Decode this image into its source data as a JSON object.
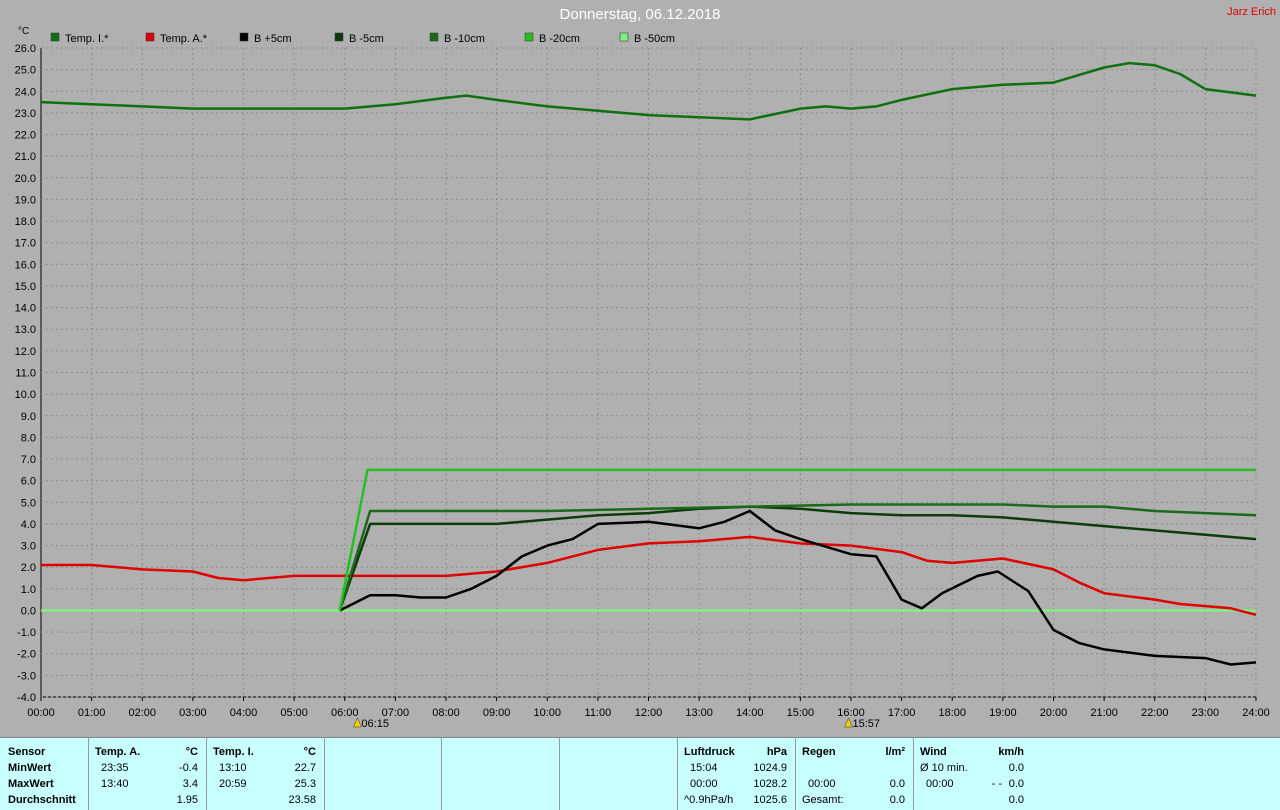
{
  "title": "Donnerstag, 06.12.2018",
  "user": "Jarz Erich",
  "unit": "°C",
  "legend": [
    {
      "label": "Temp. I.*",
      "color": "#107010"
    },
    {
      "label": "Temp. A.*",
      "color": "#e00000"
    },
    {
      "label": "B +5cm",
      "color": "#000000"
    },
    {
      "label": "B -5cm",
      "color": "#0c3c0c"
    },
    {
      "label": "B -10cm",
      "color": "#1a6a1a"
    },
    {
      "label": "B -20cm",
      "color": "#22c022"
    },
    {
      "label": "B -50cm",
      "color": "#80f080"
    }
  ],
  "sunrise": "06:15",
  "sunset": "15:57",
  "colors": {
    "background": "#b0b0b0",
    "panel": "#c8ffff",
    "title": "#ffffff",
    "user": "#e00000"
  },
  "chart_data": {
    "type": "line",
    "title": "Donnerstag, 06.12.2018",
    "ylabel": "°C",
    "ylim": [
      -4,
      26
    ],
    "xlim": [
      0,
      24
    ],
    "x_ticks": [
      "00:00",
      "01:00",
      "02:00",
      "03:00",
      "04:00",
      "05:00",
      "06:00",
      "07:00",
      "08:00",
      "09:00",
      "10:00",
      "11:00",
      "12:00",
      "13:00",
      "14:00",
      "15:00",
      "16:00",
      "17:00",
      "18:00",
      "19:00",
      "20:00",
      "21:00",
      "22:00",
      "23:00",
      "24:00"
    ],
    "y_ticks": [
      "-4.0",
      "-3.0",
      "-2.0",
      "-1.0",
      "0.0",
      "1.0",
      "2.0",
      "3.0",
      "4.0",
      "5.0",
      "6.0",
      "7.0",
      "8.0",
      "9.0",
      "10.0",
      "11.0",
      "12.0",
      "13.0",
      "14.0",
      "15.0",
      "16.0",
      "17.0",
      "18.0",
      "19.0",
      "20.0",
      "21.0",
      "22.0",
      "23.0",
      "24.0",
      "25.0",
      "26.0"
    ],
    "grid": true,
    "series": [
      {
        "name": "Temp. I.*",
        "color": "#107010",
        "points": [
          [
            0,
            23.5
          ],
          [
            1,
            23.4
          ],
          [
            2,
            23.3
          ],
          [
            3,
            23.2
          ],
          [
            4,
            23.2
          ],
          [
            5,
            23.2
          ],
          [
            6,
            23.2
          ],
          [
            7,
            23.4
          ],
          [
            8,
            23.7
          ],
          [
            8.4,
            23.8
          ],
          [
            9,
            23.6
          ],
          [
            10,
            23.3
          ],
          [
            11,
            23.1
          ],
          [
            12,
            22.9
          ],
          [
            13,
            22.8
          ],
          [
            14,
            22.7
          ],
          [
            15,
            23.2
          ],
          [
            15.5,
            23.3
          ],
          [
            16,
            23.2
          ],
          [
            16.5,
            23.3
          ],
          [
            17,
            23.6
          ],
          [
            18,
            24.1
          ],
          [
            19,
            24.3
          ],
          [
            20,
            24.4
          ],
          [
            21,
            25.1
          ],
          [
            21.5,
            25.3
          ],
          [
            22,
            25.2
          ],
          [
            22.5,
            24.8
          ],
          [
            23,
            24.1
          ],
          [
            24,
            23.8
          ]
        ]
      },
      {
        "name": "Temp. A.*",
        "color": "#e00000",
        "points": [
          [
            0,
            2.1
          ],
          [
            1,
            2.1
          ],
          [
            2,
            1.9
          ],
          [
            3,
            1.8
          ],
          [
            3.5,
            1.5
          ],
          [
            4,
            1.4
          ],
          [
            5,
            1.6
          ],
          [
            6,
            1.6
          ],
          [
            7,
            1.6
          ],
          [
            8,
            1.6
          ],
          [
            9,
            1.8
          ],
          [
            10,
            2.2
          ],
          [
            11,
            2.8
          ],
          [
            12,
            3.1
          ],
          [
            13,
            3.2
          ],
          [
            14,
            3.4
          ],
          [
            15,
            3.1
          ],
          [
            16,
            3.0
          ],
          [
            17,
            2.7
          ],
          [
            17.5,
            2.3
          ],
          [
            18,
            2.2
          ],
          [
            19,
            2.4
          ],
          [
            20,
            1.9
          ],
          [
            20.5,
            1.3
          ],
          [
            21,
            0.8
          ],
          [
            22,
            0.5
          ],
          [
            22.5,
            0.3
          ],
          [
            23,
            0.2
          ],
          [
            23.5,
            0.1
          ],
          [
            24,
            -0.2
          ]
        ]
      },
      {
        "name": "B +5cm",
        "color": "#000000",
        "points": [
          [
            5.9,
            0
          ],
          [
            6.5,
            0.7
          ],
          [
            7,
            0.7
          ],
          [
            7.5,
            0.6
          ],
          [
            8,
            0.6
          ],
          [
            8.5,
            1.0
          ],
          [
            9,
            1.6
          ],
          [
            9.5,
            2.5
          ],
          [
            10,
            3.0
          ],
          [
            10.5,
            3.3
          ],
          [
            11,
            4.0
          ],
          [
            12,
            4.1
          ],
          [
            13,
            3.8
          ],
          [
            13.5,
            4.1
          ],
          [
            14,
            4.6
          ],
          [
            14.5,
            3.7
          ],
          [
            15,
            3.3
          ],
          [
            16,
            2.6
          ],
          [
            16.5,
            2.5
          ],
          [
            17,
            0.5
          ],
          [
            17.4,
            0.1
          ],
          [
            17.8,
            0.8
          ],
          [
            18.5,
            1.6
          ],
          [
            18.9,
            1.8
          ],
          [
            19.5,
            0.9
          ],
          [
            20,
            -0.9
          ],
          [
            20.5,
            -1.5
          ],
          [
            21,
            -1.8
          ],
          [
            22,
            -2.1
          ],
          [
            23,
            -2.2
          ],
          [
            23.5,
            -2.5
          ],
          [
            24,
            -2.4
          ]
        ]
      },
      {
        "name": "B -5cm",
        "color": "#0c3c0c",
        "points": [
          [
            5.9,
            0
          ],
          [
            6.5,
            4.0
          ],
          [
            8,
            4.0
          ],
          [
            9,
            4.0
          ],
          [
            10,
            4.2
          ],
          [
            11,
            4.4
          ],
          [
            12,
            4.5
          ],
          [
            13,
            4.7
          ],
          [
            14,
            4.8
          ],
          [
            15,
            4.7
          ],
          [
            16,
            4.5
          ],
          [
            17,
            4.4
          ],
          [
            18,
            4.4
          ],
          [
            19,
            4.3
          ],
          [
            20,
            4.1
          ],
          [
            21,
            3.9
          ],
          [
            22,
            3.7
          ],
          [
            23,
            3.5
          ],
          [
            24,
            3.3
          ]
        ]
      },
      {
        "name": "B -10cm",
        "color": "#1a6a1a",
        "points": [
          [
            5.9,
            0
          ],
          [
            6.5,
            4.6
          ],
          [
            8,
            4.6
          ],
          [
            10,
            4.6
          ],
          [
            12,
            4.7
          ],
          [
            14,
            4.8
          ],
          [
            16,
            4.9
          ],
          [
            18,
            4.9
          ],
          [
            19,
            4.9
          ],
          [
            20,
            4.8
          ],
          [
            21,
            4.8
          ],
          [
            22,
            4.6
          ],
          [
            23,
            4.5
          ],
          [
            24,
            4.4
          ]
        ]
      },
      {
        "name": "B -20cm",
        "color": "#22c022",
        "points": [
          [
            5.9,
            0
          ],
          [
            6.45,
            6.5
          ],
          [
            24,
            6.5
          ]
        ]
      },
      {
        "name": "B -50cm",
        "color": "#80f080",
        "points": [
          [
            0,
            0
          ],
          [
            24,
            0
          ]
        ]
      }
    ]
  },
  "stats": {
    "sensor_header": "Sensor",
    "rows": [
      "MinWert",
      "MaxWert",
      "Durchschnitt"
    ],
    "temp_a": {
      "header": "Temp. A.",
      "unit": "°C",
      "min_time": "23:35",
      "min_val": "-0.4",
      "max_time": "13:40",
      "max_val": "3.4",
      "avg": "1.95"
    },
    "temp_i": {
      "header": "Temp. I.",
      "unit": "°C",
      "min_time": "13:10",
      "min_val": "22.7",
      "max_time": "20:59",
      "max_val": "25.3",
      "avg": "23.58"
    },
    "pressure": {
      "header": "Luftdruck",
      "unit": "hPa",
      "r1_time": "15:04",
      "r1_val": "1024.9",
      "r2_time": "00:00",
      "r2_val": "1028.2",
      "r3_label": "^0.9hPa/h",
      "r3_val": "1025.6"
    },
    "rain": {
      "header": "Regen",
      "unit": "l/m²",
      "r2_time": "00:00",
      "r2_val": "0.0",
      "r3_label": "Gesamt:",
      "r3_val": "0.0"
    },
    "wind": {
      "header": "Wind",
      "unit": "km/h",
      "r1_label": "Ø 10 min.",
      "r1_val": "0.0",
      "r2_time": "00:00",
      "r2_dir": "- -",
      "r2_val": "0.0",
      "r3_val": "0.0"
    }
  }
}
